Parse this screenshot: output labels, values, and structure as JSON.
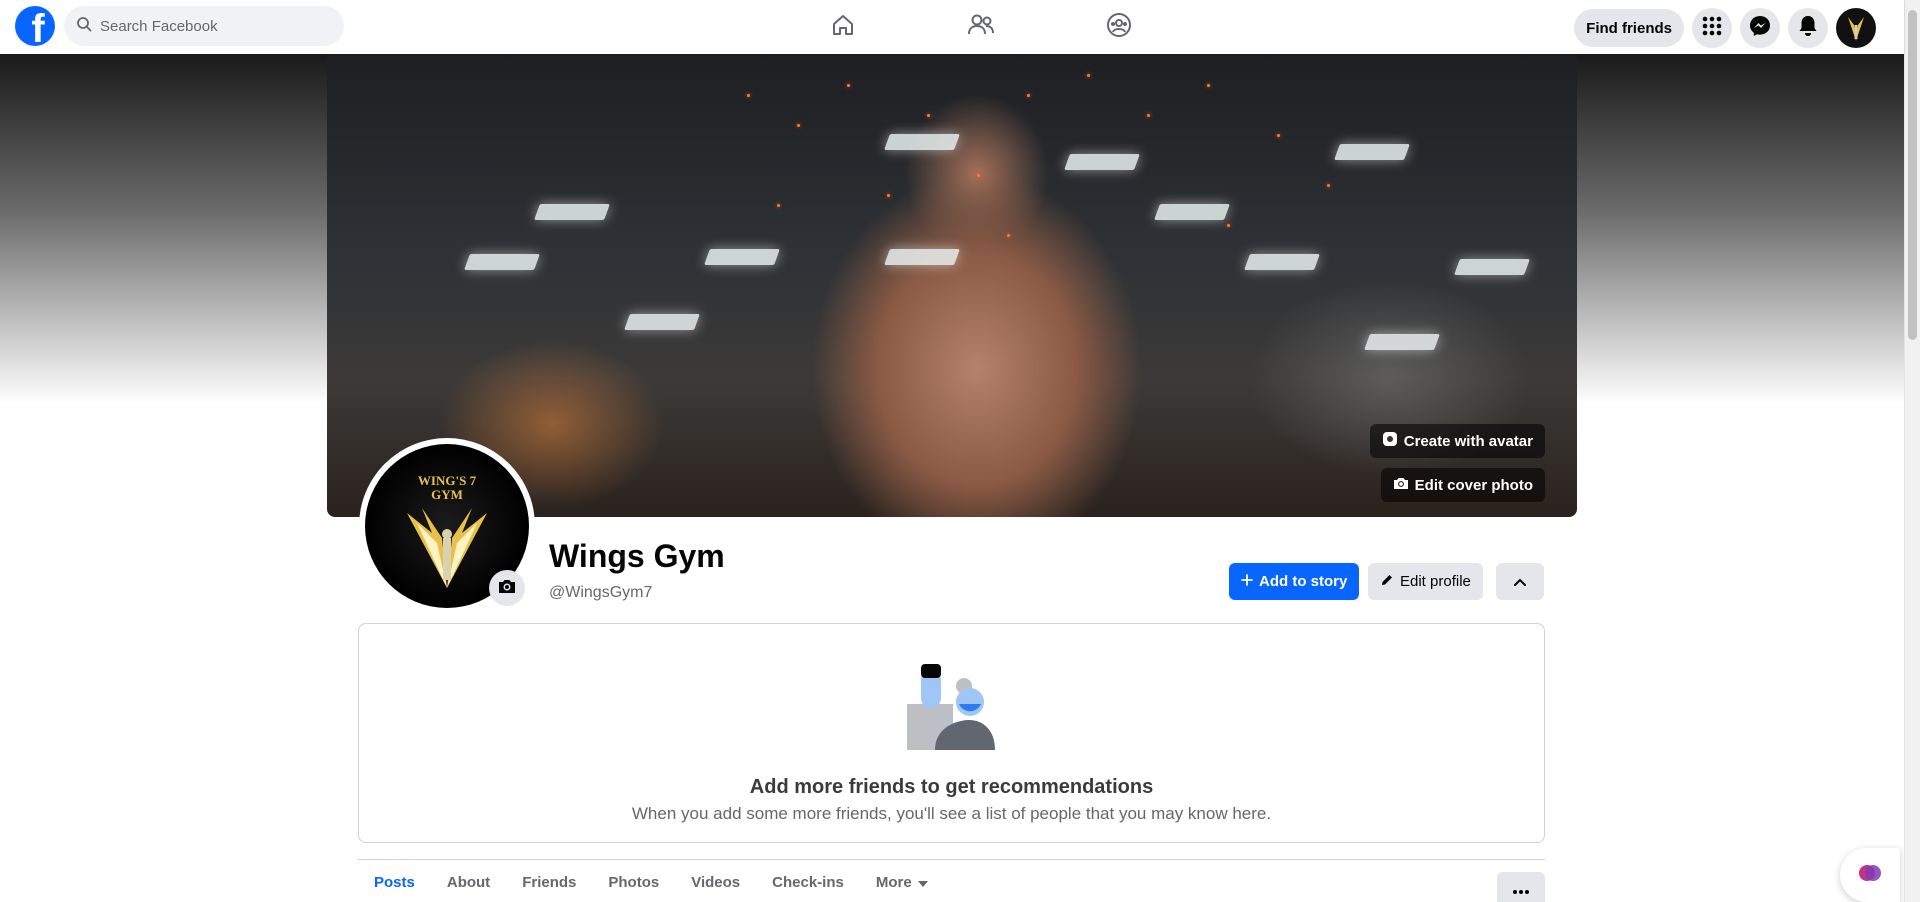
{
  "topbar": {
    "logo_letter": "f",
    "search_placeholder": "Search Facebook",
    "find_friends_label": "Find friends",
    "nav_icons": [
      "home-icon",
      "friends-icon",
      "groups-icon"
    ],
    "right_icons": [
      "menu-grid-icon",
      "messenger-icon",
      "notifications-icon",
      "account-avatar"
    ]
  },
  "cover": {
    "create_avatar_label": "Create with avatar",
    "edit_cover_label": "Edit cover photo"
  },
  "profile": {
    "name": "Wings Gym",
    "handle": "@WingsGym7",
    "pic_text_line1": "WING'S 7",
    "pic_text_line2": "GYM",
    "add_story_label": "Add to story",
    "edit_profile_label": "Edit profile"
  },
  "recommendations": {
    "title": "Add more friends to get recommendations",
    "subtitle": "When you add some more friends, you'll see a list of people that you may know here."
  },
  "tabs": [
    {
      "label": "Posts",
      "active": true
    },
    {
      "label": "About"
    },
    {
      "label": "Friends"
    },
    {
      "label": "Photos"
    },
    {
      "label": "Videos"
    },
    {
      "label": "Check-ins"
    },
    {
      "label": "More"
    }
  ],
  "colors": {
    "brand": "#0866ff",
    "secondary_button": "#e4e6eb",
    "muted_text": "#65676b"
  }
}
